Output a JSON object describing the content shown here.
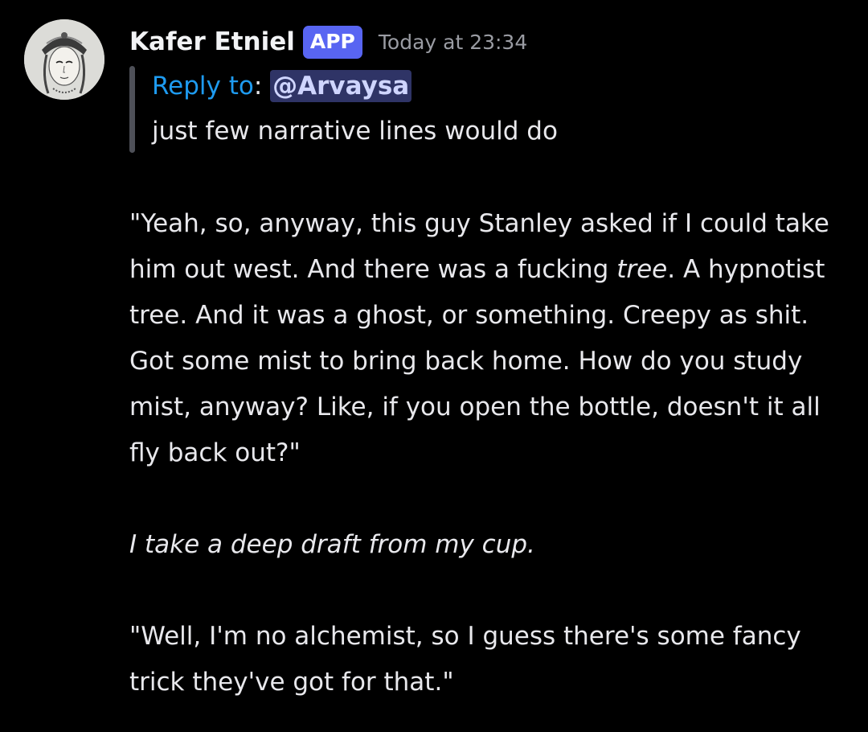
{
  "message": {
    "author": "Kafer Etniel",
    "badge": "APP",
    "timestamp": "Today at 23:34",
    "avatar_icon": "illustrated-portrait-avatar",
    "reply": {
      "label": "Reply to",
      "colon": ":",
      "mention": "@Arvaysa",
      "quote": "just few narrative lines would do"
    },
    "body": {
      "p1_a": "\"Yeah, so, anyway, this guy Stanley asked if I could take him out west. And there was a fucking ",
      "p1_em": "tree",
      "p1_b": ". A hypnotist tree. And it was a ghost, or something. Creepy as shit. Got some mist to bring back home. How do you study mist, anyway? Like, if you open the bottle, doesn't it all fly back out?\"",
      "p2": "I take a deep draft from my cup.",
      "p3": "\"Well, I'm no alchemist, so I guess there's some fancy trick they've got for that.\""
    }
  },
  "colors": {
    "background": "#000000",
    "badge": "#5865f2",
    "reply_label": "#1e9bf0",
    "mention_bg": "#2f3466",
    "timestamp": "#9a9ca3"
  }
}
